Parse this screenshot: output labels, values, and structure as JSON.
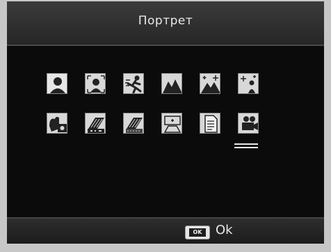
{
  "header": {
    "title": "Портрет"
  },
  "scene_modes": {
    "row1": [
      {
        "icon": "portrait-icon",
        "selected": true
      },
      {
        "icon": "face-icon",
        "selected": false
      },
      {
        "icon": "sports-icon",
        "selected": false
      },
      {
        "icon": "landscape-icon",
        "selected": false
      },
      {
        "icon": "night-landscape-icon",
        "selected": false
      },
      {
        "icon": "night-portrait-icon",
        "selected": false
      }
    ],
    "row2": [
      {
        "icon": "high-sensitivity-icon",
        "selected": false
      },
      {
        "icon": "bw-film-icon",
        "selected": false
      },
      {
        "icon": "sepia-film-icon",
        "selected": false
      },
      {
        "icon": "oblique-correction-icon",
        "selected": false
      },
      {
        "icon": "text-mode-icon",
        "selected": false
      },
      {
        "icon": "movie-icon",
        "selected": false,
        "cursor": true
      }
    ]
  },
  "footer": {
    "ok_key_label": "OK",
    "ok_text": "Ok"
  }
}
